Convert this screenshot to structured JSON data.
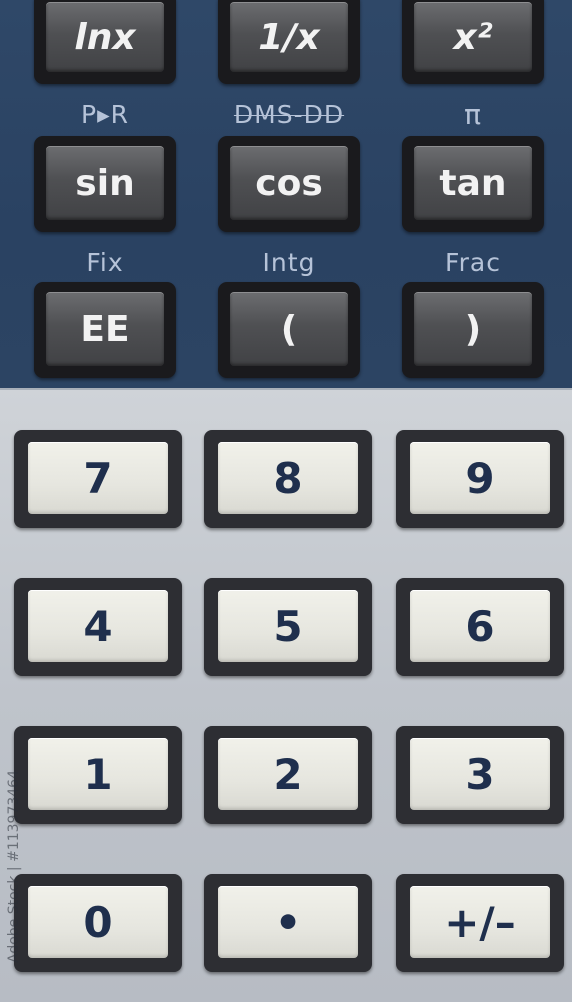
{
  "function_keys": {
    "row1": [
      "lnx",
      "1/x",
      "x²"
    ],
    "row2": [
      "sin",
      "cos",
      "tan"
    ],
    "row3": [
      "EE",
      "(",
      ")"
    ]
  },
  "shift_labels": {
    "row2": [
      "P▸R",
      "DMS-DD",
      "π"
    ],
    "row3": [
      "Fix",
      "Intg",
      "Frac"
    ]
  },
  "number_keys": {
    "row1": [
      "7",
      "8",
      "9"
    ],
    "row2": [
      "4",
      "5",
      "6"
    ],
    "row3": [
      "1",
      "2",
      "3"
    ],
    "row4": [
      "0",
      "•",
      "+/–"
    ]
  },
  "watermark": "Adobe Stock | #113973464",
  "colors": {
    "top_panel": "#2c4463",
    "bottom_panel": "#c3c8cf",
    "dark_key": "#4f5053",
    "light_key": "#e6e6df",
    "light_key_text": "#1f2f4d",
    "shift_text": "#b6c3d8"
  }
}
